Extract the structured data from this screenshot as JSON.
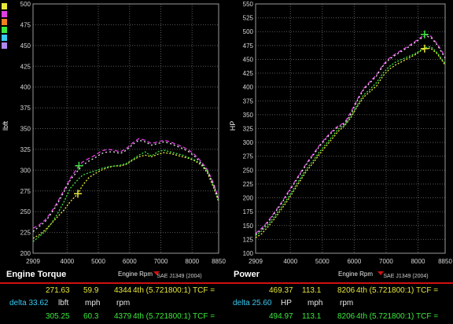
{
  "colors": {
    "yellow": "#e8e83a",
    "green": "#3ce83c",
    "magenta": "#e040e0",
    "white": "#e8e8e8",
    "cyan": "#38c8f0",
    "red": "#d01010",
    "grid": "#5a5a5a"
  },
  "swatches": [
    "#e8e83a",
    "#e040e0",
    "#f08020",
    "#3ce83c",
    "#38c8f0",
    "#b088f0"
  ],
  "chart_data": [
    {
      "type": "line",
      "title": "Engine Torque",
      "xlabel": "Engine Rpm",
      "ylabel": "lbft",
      "standard": "SAE J1349 (2004)",
      "xlim": [
        2909,
        8850
      ],
      "ylim": [
        200,
        500
      ],
      "xticks": [
        "2909",
        "4000",
        "5000",
        "6000",
        "7000",
        "8000",
        "8850"
      ],
      "xtick_values": [
        2909,
        4000,
        5000,
        6000,
        7000,
        8000,
        8850
      ],
      "yticks": [
        "200",
        "225",
        "250",
        "275",
        "300",
        "325",
        "350",
        "375",
        "400",
        "425",
        "450",
        "475",
        "500"
      ],
      "ytick_values": [
        200,
        225,
        250,
        275,
        300,
        325,
        350,
        375,
        400,
        425,
        450,
        475,
        500
      ],
      "grid": true,
      "series": [
        {
          "color": "yellow",
          "dash": "2,2",
          "x": [
            2909,
            3100,
            3300,
            3500,
            3700,
            3900,
            4100,
            4344,
            4500,
            4700,
            4900,
            5100,
            5300,
            5500,
            5700,
            5900,
            6100,
            6300,
            6500,
            6700,
            6900,
            7100,
            7300,
            7500,
            7700,
            7900,
            8100,
            8300,
            8500,
            8700,
            8850
          ],
          "y": [
            218,
            222,
            228,
            236,
            244,
            252,
            262,
            271.6,
            282,
            291,
            296,
            300,
            303,
            305,
            305,
            307,
            312,
            316,
            318,
            316,
            319,
            321,
            320,
            318,
            316,
            314,
            311,
            306,
            296,
            278,
            262
          ]
        },
        {
          "color": "green",
          "dash": "2,2",
          "x": [
            2909,
            3100,
            3300,
            3500,
            3700,
            3900,
            4100,
            4379,
            4500,
            4700,
            4900,
            5100,
            5300,
            5500,
            5700,
            5900,
            6100,
            6300,
            6500,
            6700,
            6900,
            7100,
            7300,
            7500,
            7700,
            7900,
            8100,
            8300,
            8500,
            8700,
            8850
          ],
          "y": [
            214,
            220,
            226,
            236,
            248,
            262,
            278,
            290,
            294,
            297,
            299,
            302,
            304,
            305,
            306,
            308,
            313,
            318,
            322,
            317,
            322,
            324,
            322,
            320,
            318,
            315,
            312,
            307,
            298,
            280,
            264
          ]
        },
        {
          "color": "magenta",
          "dash": "5,3",
          "x": [
            2909,
            3100,
            3300,
            3500,
            3700,
            3900,
            4100,
            4379,
            4500,
            4700,
            4900,
            5100,
            5300,
            5500,
            5700,
            5900,
            6100,
            6300,
            6500,
            6700,
            6900,
            7100,
            7300,
            7500,
            7700,
            7900,
            8100,
            8300,
            8500,
            8700,
            8850
          ],
          "y": [
            230,
            234,
            240,
            250,
            262,
            276,
            290,
            305.3,
            310,
            314,
            318,
            323,
            325,
            324,
            322,
            326,
            333,
            338,
            336,
            332,
            334,
            336,
            334,
            331,
            328,
            324,
            318,
            310,
            300,
            283,
            266
          ]
        },
        {
          "color": "white",
          "dash": "2,3",
          "x": [
            2909,
            3100,
            3300,
            3500,
            3700,
            3900,
            4100,
            4379,
            4500,
            4700,
            4900,
            5100,
            5300,
            5500,
            5700,
            5900,
            6100,
            6300,
            6500,
            6700,
            6900,
            7100,
            7300,
            7500,
            7700,
            7900,
            8100,
            8300,
            8500,
            8700,
            8850
          ],
          "y": [
            226,
            232,
            238,
            248,
            260,
            274,
            288,
            301,
            306,
            311,
            315,
            320,
            322,
            322,
            320,
            324,
            331,
            336,
            334,
            330,
            332,
            334,
            332,
            329,
            326,
            322,
            316,
            308,
            298,
            281,
            264
          ]
        }
      ],
      "markers": [
        {
          "color": "yellow",
          "x": 4344,
          "y": 271.63
        },
        {
          "color": "green",
          "x": 4379,
          "y": 305.25
        }
      ]
    },
    {
      "type": "line",
      "title": "Power",
      "xlabel": "Engine Rpm",
      "ylabel": "HP",
      "standard": "SAE J1349 (2004)",
      "xlim": [
        2909,
        8850
      ],
      "ylim": [
        100,
        550
      ],
      "xticks": [
        "2909",
        "4000",
        "5000",
        "6000",
        "7000",
        "8000",
        "8850"
      ],
      "xtick_values": [
        2909,
        4000,
        5000,
        6000,
        7000,
        8000,
        8850
      ],
      "yticks": [
        "100",
        "125",
        "150",
        "175",
        "200",
        "225",
        "250",
        "275",
        "300",
        "325",
        "350",
        "375",
        "400",
        "425",
        "450",
        "475",
        "500",
        "525",
        "550"
      ],
      "ytick_values": [
        100,
        125,
        150,
        175,
        200,
        225,
        250,
        275,
        300,
        325,
        350,
        375,
        400,
        425,
        450,
        475,
        500,
        525,
        550
      ],
      "grid": true,
      "series": [
        {
          "color": "yellow",
          "dash": "2,2",
          "x": [
            2909,
            3100,
            3300,
            3500,
            3700,
            3900,
            4100,
            4300,
            4500,
            4700,
            4900,
            5100,
            5300,
            5500,
            5700,
            5900,
            6100,
            6300,
            6500,
            6700,
            6900,
            7100,
            7300,
            7500,
            7700,
            7900,
            8100,
            8206,
            8400,
            8600,
            8850
          ],
          "y": [
            128,
            135,
            148,
            162,
            178,
            194,
            212,
            230,
            248,
            262,
            278,
            292,
            306,
            320,
            330,
            345,
            365,
            382,
            392,
            402,
            420,
            432,
            440,
            446,
            452,
            458,
            466,
            469.4,
            470,
            460,
            440
          ]
        },
        {
          "color": "green",
          "dash": "2,2",
          "x": [
            2909,
            3100,
            3300,
            3500,
            3700,
            3900,
            4100,
            4300,
            4500,
            4700,
            4900,
            5100,
            5300,
            5500,
            5700,
            5900,
            6100,
            6300,
            6500,
            6700,
            6900,
            7100,
            7300,
            7500,
            7700,
            7900,
            8100,
            8206,
            8400,
            8600,
            8850
          ],
          "y": [
            132,
            140,
            152,
            166,
            182,
            198,
            216,
            234,
            252,
            266,
            282,
            296,
            310,
            324,
            332,
            348,
            368,
            386,
            396,
            408,
            425,
            437,
            445,
            450,
            455,
            460,
            467,
            471,
            473,
            462,
            442
          ]
        },
        {
          "color": "magenta",
          "dash": "5,3",
          "x": [
            2909,
            3100,
            3300,
            3500,
            3700,
            3900,
            4100,
            4300,
            4500,
            4700,
            4900,
            5100,
            5300,
            5500,
            5700,
            5900,
            6100,
            6300,
            6500,
            6700,
            6900,
            7100,
            7300,
            7500,
            7700,
            7900,
            8100,
            8206,
            8400,
            8600,
            8850
          ],
          "y": [
            136,
            145,
            158,
            174,
            190,
            208,
            226,
            244,
            262,
            278,
            294,
            308,
            320,
            330,
            336,
            355,
            378,
            398,
            410,
            422,
            440,
            452,
            460,
            467,
            474,
            482,
            490,
            495,
            492,
            478,
            455
          ]
        },
        {
          "color": "white",
          "dash": "2,3",
          "x": [
            2909,
            3100,
            3300,
            3500,
            3700,
            3900,
            4100,
            4300,
            4500,
            4700,
            4900,
            5100,
            5300,
            5500,
            5700,
            5900,
            6100,
            6300,
            6500,
            6700,
            6900,
            7100,
            7300,
            7500,
            7700,
            7900,
            8100,
            8206,
            8400,
            8600,
            8850
          ],
          "y": [
            134,
            143,
            156,
            172,
            188,
            206,
            224,
            242,
            260,
            276,
            292,
            306,
            318,
            328,
            334,
            352,
            376,
            396,
            408,
            420,
            438,
            450,
            458,
            465,
            472,
            480,
            488,
            492,
            490,
            476,
            452
          ]
        }
      ],
      "markers": [
        {
          "color": "yellow",
          "x": 8206,
          "y": 469.37
        },
        {
          "color": "green",
          "x": 8206,
          "y": 494.97
        }
      ]
    }
  ],
  "footer": {
    "left": {
      "yellow_row": {
        "value": "271.63",
        "mph": "59.9",
        "rpm": "4344",
        "gear": "4th (5.721800:1) TCF ="
      },
      "delta_label": "delta 33.62",
      "units_value": "lbft",
      "units_mph": "mph",
      "units_rpm": "rpm",
      "green_row": {
        "value": "305.25",
        "mph": "60.3",
        "rpm": "4379",
        "gear": "4th (5.721800:1) TCF ="
      }
    },
    "right": {
      "yellow_row": {
        "value": "469.37",
        "mph": "113.1",
        "rpm": "8206",
        "gear": "4th (5.721800:1) TCF ="
      },
      "delta_label": "delta 25.60",
      "units_value": "HP",
      "units_mph": "mph",
      "units_rpm": "rpm",
      "green_row": {
        "value": "494.97",
        "mph": "113.1",
        "rpm": "8206",
        "gear": "4th (5.721800:1) TCF ="
      }
    }
  }
}
